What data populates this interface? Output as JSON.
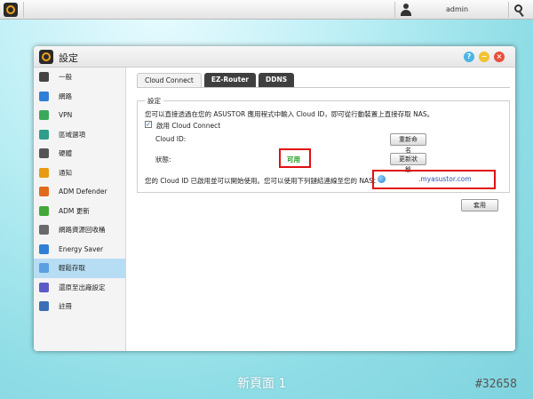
{
  "taskbar": {
    "username": "admin"
  },
  "window": {
    "title": "設定",
    "help_label": "?",
    "min_label": "−",
    "close_label": "×"
  },
  "sidebar": {
    "items": [
      {
        "label": "一般",
        "icon": "general-icon",
        "color": "#444444"
      },
      {
        "label": "網路",
        "icon": "network-icon",
        "color": "#2f7fd6"
      },
      {
        "label": "VPN",
        "icon": "vpn-icon",
        "color": "#3aa85a"
      },
      {
        "label": "區域選項",
        "icon": "regional-icon",
        "color": "#2e9e8a"
      },
      {
        "label": "硬體",
        "icon": "hardware-icon",
        "color": "#555555"
      },
      {
        "label": "通知",
        "icon": "notification-icon",
        "color": "#e89b12"
      },
      {
        "label": "ADM Defender",
        "icon": "defender-icon",
        "color": "#e06a1c"
      },
      {
        "label": "ADM 更新",
        "icon": "update-icon",
        "color": "#43a83a"
      },
      {
        "label": "網路資源回收桶",
        "icon": "recycle-bin-icon",
        "color": "#6a6a6a"
      },
      {
        "label": "Energy Saver",
        "icon": "energy-icon",
        "color": "#2f7fd6"
      },
      {
        "label": "輕鬆存取",
        "icon": "cloud-icon",
        "color": "#5a9fe0"
      },
      {
        "label": "還原至出廠設定",
        "icon": "restore-icon",
        "color": "#5b5bc8"
      },
      {
        "label": "註冊",
        "icon": "register-icon",
        "color": "#3a6fb8"
      }
    ],
    "active_index": 10
  },
  "tabs": [
    {
      "label": "Cloud Connect",
      "active": true
    },
    {
      "label": "EZ-Router",
      "active": false
    },
    {
      "label": "DDNS",
      "active": false
    }
  ],
  "settings": {
    "legend": "設定",
    "description": "您可以直接透過在您的 ASUSTOR 應用程式中輸入 Cloud ID，即可從行動裝置上直接存取 NAS。",
    "checkbox_mark": "✓",
    "enable_label": "啟用 Cloud Connect",
    "cloud_id_label": "Cloud ID:",
    "cloud_id_value": "",
    "rename_button": "重新命名",
    "status_label": "狀態:",
    "status_value": "可用",
    "refresh_button": "更新狀態",
    "access_text": "您的 Cloud ID 已啟用並可以開始使用。您可以使用下列鏈結連線至您的 NAS：",
    "access_domain": ".myasustor.com"
  },
  "apply_button": "套用",
  "desktop": {
    "page_label": "新頁面 1",
    "watermark": "#32658"
  }
}
